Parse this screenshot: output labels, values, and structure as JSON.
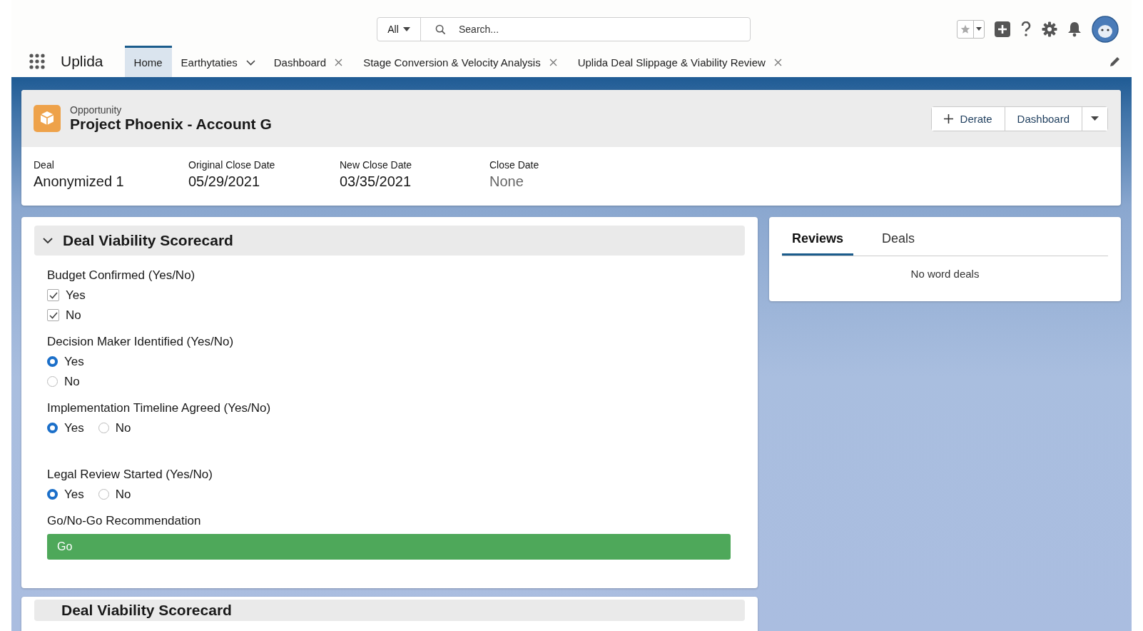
{
  "header": {
    "search_scope": "All",
    "search_placeholder": "Search...",
    "app_name": "Uplida"
  },
  "nav_tabs": [
    {
      "label": "Home",
      "kind": "plain",
      "selected": true
    },
    {
      "label": "Earthytaties",
      "kind": "menu",
      "selected": false
    },
    {
      "label": "Dashboard",
      "kind": "closable",
      "selected": false
    },
    {
      "label": "Stage Conversion & Velocity Analysis",
      "kind": "closable",
      "selected": false
    },
    {
      "label": "Uplida Deal Slippage & Viability Review",
      "kind": "closable",
      "selected": false
    }
  ],
  "record": {
    "object_type": "Opportunity",
    "title": "Project Phoenix - Account G",
    "actions": [
      "Derate",
      "Dashboard"
    ],
    "fields": [
      {
        "label": "Deal",
        "value": "Anonymized 1",
        "muted": false
      },
      {
        "label": "Original Close Date",
        "value": "05/29/2021",
        "muted": false
      },
      {
        "label": "New Close Date",
        "value": "03/35/2021",
        "muted": false
      },
      {
        "label": "Close Date",
        "value": "None",
        "muted": true
      }
    ]
  },
  "scorecard": {
    "title": "Deal Viability Scorecard",
    "expanded": true,
    "questions": [
      {
        "label": "Budget Confirmed (Yes/No)",
        "kind": "checkbox",
        "inline": false,
        "options": [
          {
            "label": "Yes",
            "selected": true
          },
          {
            "label": "No",
            "selected": true
          }
        ]
      },
      {
        "label": "Decision Maker Identified (Yes/No)",
        "kind": "radio",
        "inline": false,
        "options": [
          {
            "label": "Yes",
            "selected": true
          },
          {
            "label": "No",
            "selected": false
          }
        ]
      },
      {
        "label": "Implementation Timeline Agreed (Yes/No)",
        "kind": "radio",
        "inline": true,
        "options": [
          {
            "label": "Yes",
            "selected": true
          },
          {
            "label": "No",
            "selected": false
          }
        ]
      },
      {
        "label": "Legal Review Started (Yes/No)",
        "kind": "radio",
        "inline": true,
        "options": [
          {
            "label": "Yes",
            "selected": true
          },
          {
            "label": "No",
            "selected": false
          }
        ]
      }
    ],
    "recommendation": {
      "label": "Go/No-Go Recommendation",
      "value": "Go"
    }
  },
  "side_panel": {
    "tabs": [
      {
        "label": "Reviews",
        "selected": true
      },
      {
        "label": "Deals",
        "selected": false
      }
    ],
    "empty_text": "No word deals"
  },
  "next_section": {
    "title": "Deal Viability Scorecard"
  }
}
